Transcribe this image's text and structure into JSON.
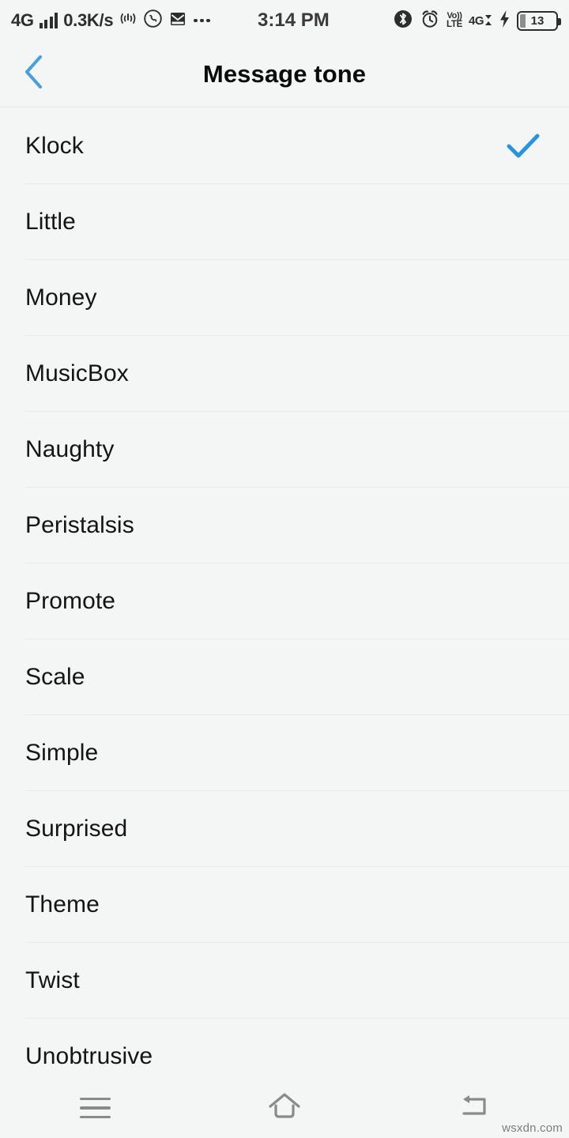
{
  "statusbar": {
    "network_label": "4G",
    "data_rate": "0.3K/s",
    "time": "3:14 PM",
    "volte_line1": "Vo))",
    "volte_line2": "LTE",
    "network_right": "4G",
    "battery_level": "13",
    "icons_left": [
      "signal-bars-icon",
      "hotspot-icon",
      "whatsapp-icon",
      "sms-icon",
      "more-dots-icon"
    ],
    "icons_right": [
      "bluetooth-icon",
      "alarm-clock-icon",
      "volte-icon",
      "data-arrows-icon",
      "charging-bolt-icon",
      "battery-icon"
    ]
  },
  "header": {
    "title": "Message tone",
    "back_icon": "chevron-left-icon",
    "accent_color": "#4a9fd8"
  },
  "list": {
    "selected": "Klock",
    "check_icon": "check-icon",
    "check_color": "#2a93dd",
    "items": [
      {
        "label": "Klock",
        "selected": true
      },
      {
        "label": "Little",
        "selected": false
      },
      {
        "label": "Money",
        "selected": false
      },
      {
        "label": "MusicBox",
        "selected": false
      },
      {
        "label": "Naughty",
        "selected": false
      },
      {
        "label": "Peristalsis",
        "selected": false
      },
      {
        "label": "Promote",
        "selected": false
      },
      {
        "label": "Scale",
        "selected": false
      },
      {
        "label": "Simple",
        "selected": false
      },
      {
        "label": "Surprised",
        "selected": false
      },
      {
        "label": "Theme",
        "selected": false
      },
      {
        "label": "Twist",
        "selected": false
      },
      {
        "label": "Unobtrusive",
        "selected": false
      }
    ]
  },
  "navbar": {
    "menu_icon": "menu-icon",
    "home_icon": "home-icon",
    "back_icon": "back-arrow-icon"
  },
  "watermark": "wsxdn.com"
}
